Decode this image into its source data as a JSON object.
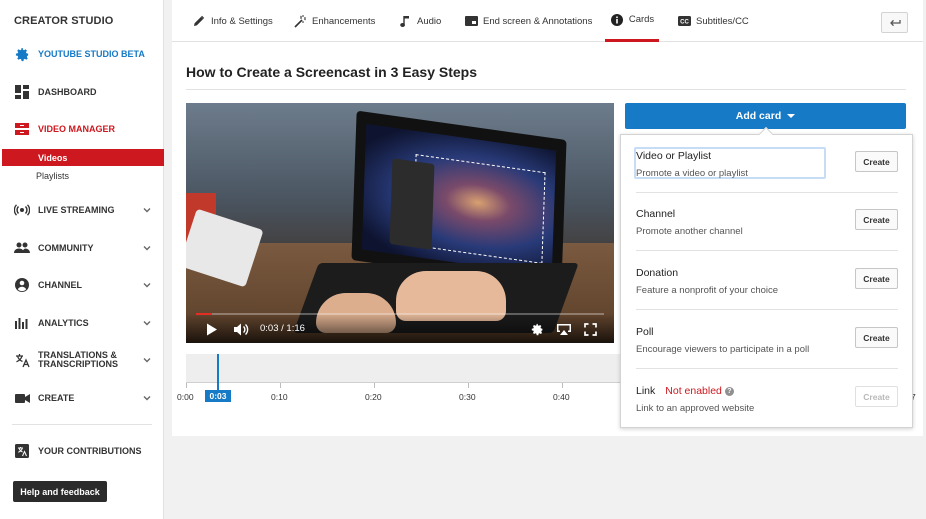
{
  "sidebar": {
    "title": "CREATOR STUDIO",
    "beta": "YOUTUBE STUDIO BETA",
    "dashboard": "DASHBOARD",
    "video_manager": "VIDEO MANAGER",
    "sub_videos": "Videos",
    "sub_playlists": "Playlists",
    "live_streaming": "LIVE STREAMING",
    "community": "COMMUNITY",
    "channel": "CHANNEL",
    "analytics": "ANALYTICS",
    "translations_1": "TRANSLATIONS &",
    "translations_2": "TRANSCRIPTIONS",
    "create": "CREATE",
    "contributions": "YOUR CONTRIBUTIONS",
    "help": "Help and feedback"
  },
  "tabs": {
    "info": "Info & Settings",
    "enhancements": "Enhancements",
    "audio": "Audio",
    "endscreen": "End screen & Annotations",
    "cards": "Cards",
    "subtitles": "Subtitles/CC"
  },
  "video": {
    "title": "How to Create a Screencast in 3 Easy Steps",
    "time_display": "0:03 / 1:16",
    "progress": 0.04
  },
  "timeline": {
    "current": "0:03",
    "ticks": [
      "0:00",
      "0:10",
      "0:20",
      "0:30",
      "0:40"
    ],
    "edge_digit": "7"
  },
  "cards": {
    "add_label": "Add card",
    "create_label": "Create",
    "items": [
      {
        "name": "Video or Playlist",
        "desc": "Promote a video or playlist"
      },
      {
        "name": "Channel",
        "desc": "Promote another channel"
      },
      {
        "name": "Donation",
        "desc": "Feature a nonprofit of your choice"
      },
      {
        "name": "Poll",
        "desc": "Encourage viewers to participate in a poll"
      },
      {
        "name": "Link",
        "desc": "Link to an approved website",
        "status": "Not enabled"
      }
    ]
  },
  "colors": {
    "accent_red": "#cc181e",
    "accent_blue": "#167ac6"
  }
}
